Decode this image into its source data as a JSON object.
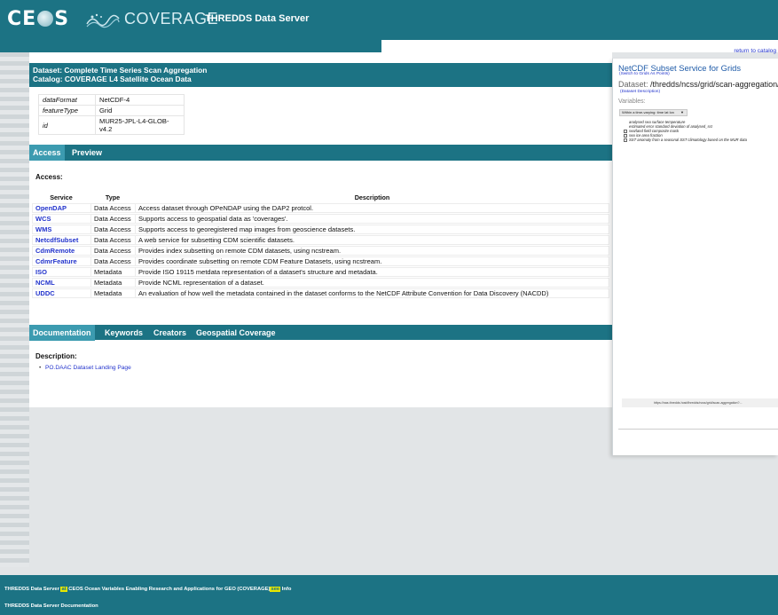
{
  "header": {
    "logo_ceos": "CE",
    "logo_ceos_end": "S",
    "logo_coverage": "COVERAGE",
    "app_title": "THREDDS Data Server"
  },
  "dataset": {
    "title": "Dataset: Complete Time Series Scan Aggregation",
    "catalog": "Catalog: COVERAGE L4 Satellite Ocean Data",
    "meta": [
      {
        "key": "dataFormat",
        "value": "NetCDF-4"
      },
      {
        "key": "featureType",
        "value": "Grid"
      },
      {
        "key": "id",
        "value": "MUR25-JPL-L4-GLOB-v4.2"
      }
    ]
  },
  "tabs": {
    "access": "Access",
    "preview": "Preview"
  },
  "access": {
    "title": "Access:",
    "columns": [
      "Service",
      "Type",
      "Description"
    ],
    "rows": [
      {
        "service": "OpenDAP",
        "type": "Data Access",
        "description": "Access dataset through OPeNDAP using the DAP2 protcol."
      },
      {
        "service": "WCS",
        "type": "Data Access",
        "description": "Supports access to geospatial data as 'coverages'."
      },
      {
        "service": "WMS",
        "type": "Data Access",
        "description": "Supports access to georegistered map images from geoscience datasets."
      },
      {
        "service": "NetcdfSubset",
        "type": "Data Access",
        "description": "A web service for subsetting CDM scientific datasets."
      },
      {
        "service": "CdmRemote",
        "type": "Data Access",
        "description": "Provides index subsetting on remote CDM datasets, using ncstream."
      },
      {
        "service": "CdmrFeature",
        "type": "Data Access",
        "description": "Provides coordinate subsetting on remote CDM Feature Datasets, using ncstream."
      },
      {
        "service": "ISO",
        "type": "Metadata",
        "description": "Provide ISO 19115 metdata representation of a dataset's structure and metadata."
      },
      {
        "service": "NCML",
        "type": "Metadata",
        "description": "Provide NCML representation of a dataset."
      },
      {
        "service": "UDDC",
        "type": "Metadata",
        "description": "An evaluation of how well the metadata contained in the dataset conforms to the NetCDF Attribute Convention for Data Discovery (NACDD)"
      }
    ]
  },
  "doc_tabs": {
    "documentation": "Documentation",
    "keywords": "Keywords",
    "creators": "Creators",
    "geospatial": "Geospatial Coverage"
  },
  "description": {
    "title": "Description:",
    "link": "PO.DAAC Dataset Landing Page"
  },
  "ncss": {
    "return_link": "return to catalog",
    "title": "NetCDF Subset Service for Grids",
    "switch_link": "(Switch to Grids As Points)",
    "dataset_label": "Dataset:",
    "dataset_path": "/thredds/ncss/grid/scan-aggregation/",
    "dataset_desc_link": "(Dataset Description)",
    "variables_label": "Variables:",
    "select_value": "Within a time-varying: time lat lon",
    "variables": [
      {
        "label": "analysed sea surface temperature",
        "checkbox": false
      },
      {
        "label": "estimated error standard deviation of analysed_sst",
        "checkbox": false
      },
      {
        "label": "sea/land field composite mask",
        "checkbox": true
      },
      {
        "label": "sea ice area fraction",
        "checkbox": true
      },
      {
        "label": "SST anomaly from a seasonal SST climatology based on the MUR data",
        "checkbox": true
      }
    ],
    "url": "https://nas.thredds.host/thredds/ncss/grid/scan-aggregation?..."
  },
  "footer": {
    "line1_a": "THREDDS Data Server",
    "line1_b": "at",
    "line1_c": "CEOS Ocean Variables Enabling Research and Applications for GEO (COVERAGE)",
    "line1_d": "see",
    "line1_e": "Info",
    "line2": "THREDDS Data Server Documentation"
  },
  "colors": {
    "brand_teal": "#1c7384",
    "tab_active": "#3c9bb0",
    "link_blue": "#2233cc",
    "highlight": "#e6e600"
  }
}
